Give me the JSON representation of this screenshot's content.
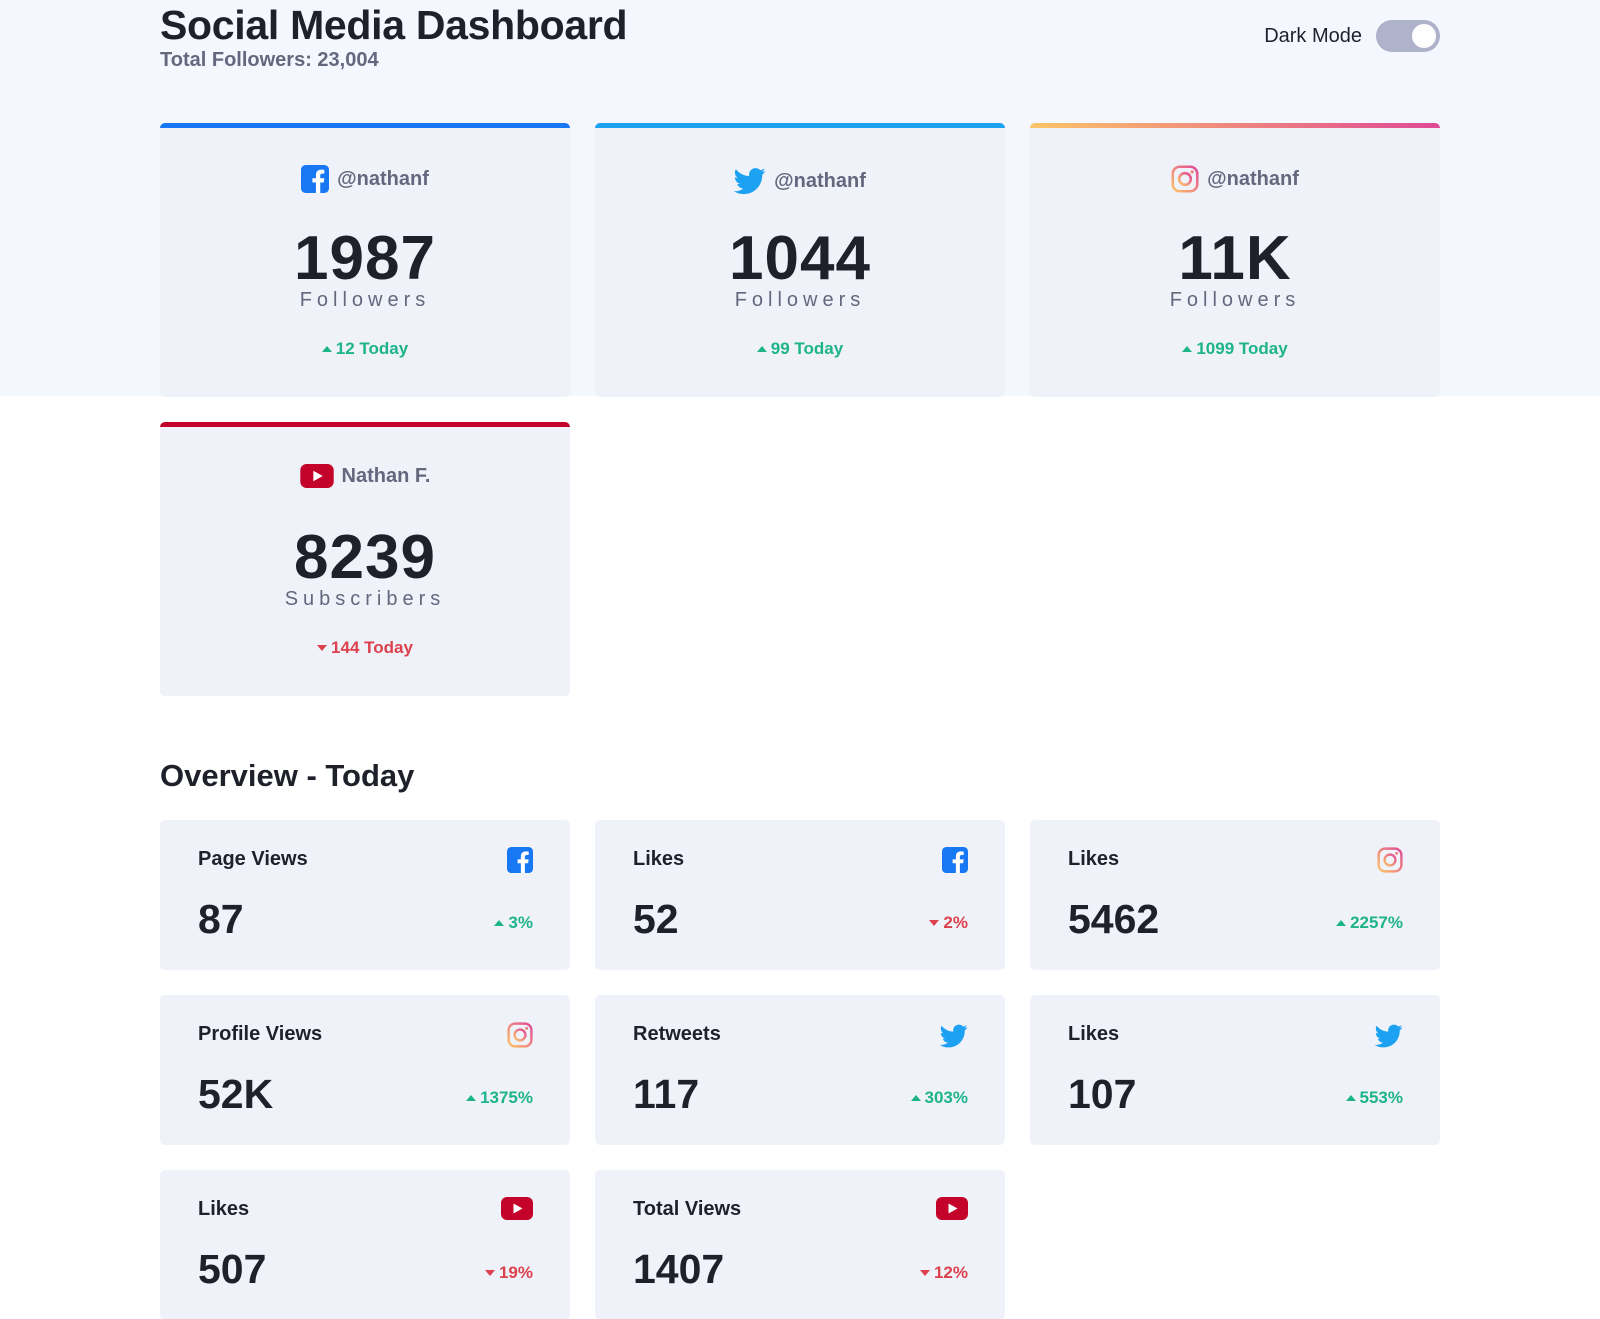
{
  "header": {
    "title": "Social Media Dashboard",
    "total_followers": "Total Followers: 23,004",
    "dark_mode_label": "Dark Mode",
    "dark_mode_on": false
  },
  "colors": {
    "facebook": "#1877f2",
    "twitter": "#1da1f2",
    "instagram_start": "#fdc468",
    "instagram_end": "#df4996",
    "youtube": "#c4032a",
    "up": "#1db489",
    "down": "#dc414c"
  },
  "followers": [
    {
      "platform": "facebook",
      "icon": "facebook-icon",
      "handle": "@nathanf",
      "count": "1987",
      "unit": "Followers",
      "change": "12 Today",
      "trend": "up"
    },
    {
      "platform": "twitter",
      "icon": "twitter-icon",
      "handle": "@nathanf",
      "count": "1044",
      "unit": "Followers",
      "change": "99 Today",
      "trend": "up"
    },
    {
      "platform": "instagram",
      "icon": "instagram-icon",
      "handle": "@nathanf",
      "count": "11K",
      "unit": "Followers",
      "change": "1099 Today",
      "trend": "up"
    },
    {
      "platform": "youtube",
      "icon": "youtube-icon",
      "handle": "Nathan F.",
      "count": "8239",
      "unit": "Subscribers",
      "change": "144 Today",
      "trend": "down"
    }
  ],
  "overview": {
    "title": "Overview - Today",
    "cards": [
      {
        "label": "Page Views",
        "platform": "facebook",
        "icon": "facebook-icon",
        "value": "87",
        "percent": "3%",
        "trend": "up"
      },
      {
        "label": "Likes",
        "platform": "facebook",
        "icon": "facebook-icon",
        "value": "52",
        "percent": "2%",
        "trend": "down"
      },
      {
        "label": "Likes",
        "platform": "instagram",
        "icon": "instagram-icon",
        "value": "5462",
        "percent": "2257%",
        "trend": "up"
      },
      {
        "label": "Profile Views",
        "platform": "instagram",
        "icon": "instagram-icon",
        "value": "52K",
        "percent": "1375%",
        "trend": "up"
      },
      {
        "label": "Retweets",
        "platform": "twitter",
        "icon": "twitter-icon",
        "value": "117",
        "percent": "303%",
        "trend": "up"
      },
      {
        "label": "Likes",
        "platform": "twitter",
        "icon": "twitter-icon",
        "value": "107",
        "percent": "553%",
        "trend": "up"
      },
      {
        "label": "Likes",
        "platform": "youtube",
        "icon": "youtube-icon",
        "value": "507",
        "percent": "19%",
        "trend": "down"
      },
      {
        "label": "Total Views",
        "platform": "youtube",
        "icon": "youtube-icon",
        "value": "1407",
        "percent": "12%",
        "trend": "down"
      }
    ]
  }
}
